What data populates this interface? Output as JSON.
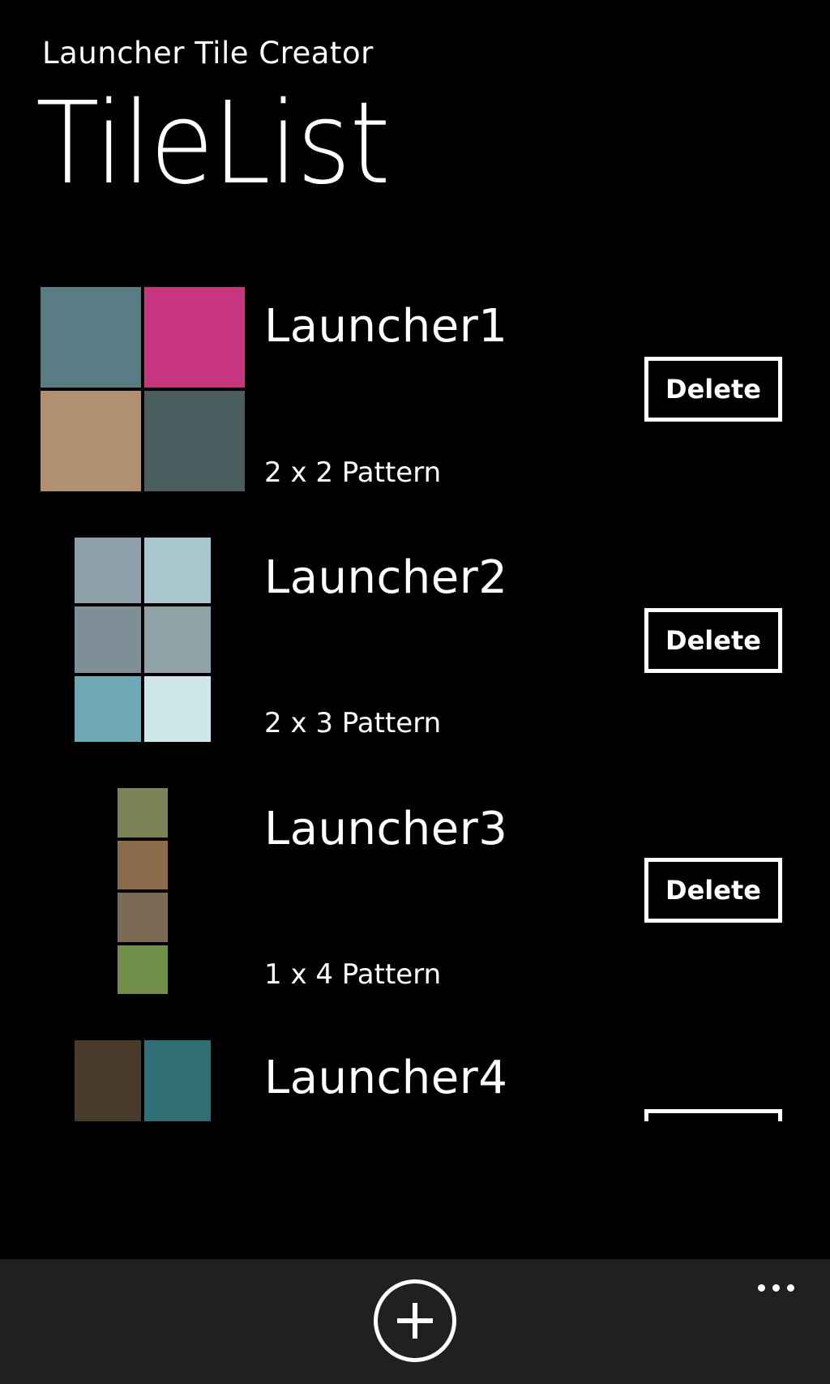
{
  "app": {
    "title": "Launcher Tile Creator",
    "page_title": "TileList"
  },
  "tiles": [
    {
      "name": "Launcher1",
      "pattern": "2 x 2 Pattern",
      "delete_label": "Delete",
      "grid": {
        "cols": 2,
        "rows": 2
      },
      "colors": [
        "#5a7c84",
        "#c7357f",
        "#b08f72",
        "#4a5d5f"
      ]
    },
    {
      "name": "Launcher2",
      "pattern": "2 x 3 Pattern",
      "delete_label": "Delete",
      "grid": {
        "cols": 2,
        "rows": 3
      },
      "colors": [
        "#8ea1ab",
        "#a9c7cf",
        "#7f8f97",
        "#8fa3a8",
        "#6fa8b5",
        "#cfe7ea"
      ]
    },
    {
      "name": "Launcher3",
      "pattern": "1 x 4 Pattern",
      "delete_label": "Delete",
      "grid": {
        "cols": 1,
        "rows": 4
      },
      "colors": [
        "#7d8158",
        "#8c6b4c",
        "#7a6a55",
        "#6f8f48"
      ]
    },
    {
      "name": "Launcher4",
      "pattern": "",
      "delete_label": "",
      "grid": {
        "cols": 2,
        "rows": 1
      },
      "colors": [
        "#4a3a2c",
        "#2e6e74"
      ]
    }
  ],
  "app_bar": {
    "add_icon": "add-icon",
    "more_icon": "more-icon"
  }
}
